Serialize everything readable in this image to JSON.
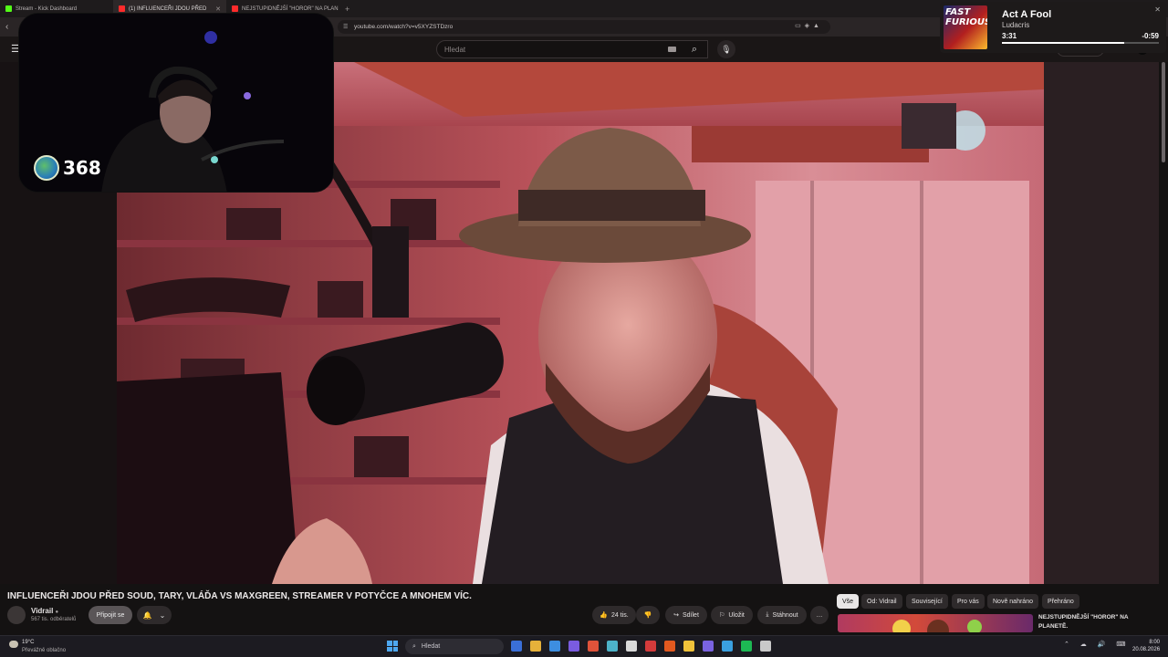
{
  "browser": {
    "tabs": [
      {
        "label": "Stream - Kick Dashboard",
        "color": "#53fc18",
        "active": false
      },
      {
        "label": "(1) INFLUENCEŘI JDOU PŘED",
        "color": "#ff2b2b",
        "active": true
      },
      {
        "label": "NEJSTUPIDNĚJŠÍ \"HOROR\" NA PLAN",
        "color": "#ff2b2b",
        "active": false
      }
    ],
    "new_tab": "+",
    "url": "youtube.com/watch?v=v5XYZSTDzro"
  },
  "youtube": {
    "search_placeholder": "Hledat",
    "video_title": "INFLUENCEŘI JDOU PŘED SOUD, TARY, VLÁĎA VS MAXGREEN, STREAMER V POTYČCE A MNOHEM VÍC.",
    "channel": {
      "name": "Vidrail",
      "subscribers": "567 tis. odběratelů"
    },
    "join_label": "Připojit se",
    "likes": "24 tis.",
    "share_label": "Sdílet",
    "save_label": "Uložit",
    "download_label": "Stáhnout",
    "more_label": "…",
    "chips": [
      "Vše",
      "Od: Vidrail",
      "Související",
      "Pro vás",
      "Nově nahráno",
      "Přehráno"
    ],
    "recommended_title": "NEJSTUPIDNĚJŠÍ \"HOROR\" NA PLANETĚ."
  },
  "overlay": {
    "viewer_count": "368"
  },
  "music": {
    "title": "Act A Fool",
    "artist": "Ludacris",
    "elapsed": "3:31",
    "remaining": "-0:59",
    "progress": 0.78,
    "album_label": "FAST FURIOUS"
  },
  "taskbar": {
    "weather_temp": "19°C",
    "weather_desc": "Převážně oblačno",
    "search_label": "Hledat",
    "time": "8:00",
    "date": "20.08.2026",
    "app_colors": [
      "#3a6fd8",
      "#e6b13a",
      "#3d8ee0",
      "#7a5ce0",
      "#e0533a",
      "#4db3c9",
      "#d9d9d9",
      "#d43b3b",
      "#e2591f",
      "#f0c23a",
      "#7a63e0",
      "#3aa0e0",
      "#1db954",
      "#c9c9c9"
    ]
  }
}
